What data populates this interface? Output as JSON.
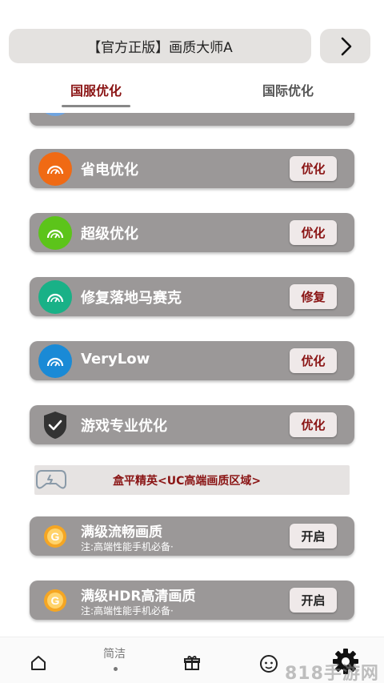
{
  "header": {
    "title": "【官方正版】画质大师A",
    "next_icon": "chevron-right-icon"
  },
  "tabs": {
    "active": "国服优化",
    "inactive": "国际优化"
  },
  "colors": {
    "accent": "#8a1414",
    "card_bg": "#9b9898"
  },
  "cards": [
    {
      "label": "省电优化",
      "button": "优化",
      "icon": "gauge-icon",
      "icon_color": "#f06a14"
    },
    {
      "label": "超级优化",
      "button": "优化",
      "icon": "gauge-icon",
      "icon_color": "#5cc41a"
    },
    {
      "label": "修复落地马赛克",
      "button": "修复",
      "icon": "gauge-icon",
      "icon_color": "#19b187"
    },
    {
      "label": "VeryLow",
      "button": "优化",
      "icon": "gauge-icon",
      "icon_color": "#1a8ad6"
    },
    {
      "label": "游戏专业优化",
      "button": "优化",
      "icon": "shield-check-icon",
      "icon_color": "#333333"
    }
  ],
  "section": {
    "title": "盒平精英<UC高端画质区域>",
    "icon": "gamepad-icon"
  },
  "premium_cards": [
    {
      "label": "满级流畅画质",
      "sub": "注:高端性能手机必备·",
      "button": "开启",
      "icon": "g-coin-icon"
    },
    {
      "label": "满级HDR高清画质",
      "sub": "注:高端性能手机必备·",
      "button": "开启",
      "icon": "g-coin-icon"
    }
  ],
  "bottom_nav": {
    "text_item": "简洁",
    "watermark": "818手游网"
  }
}
